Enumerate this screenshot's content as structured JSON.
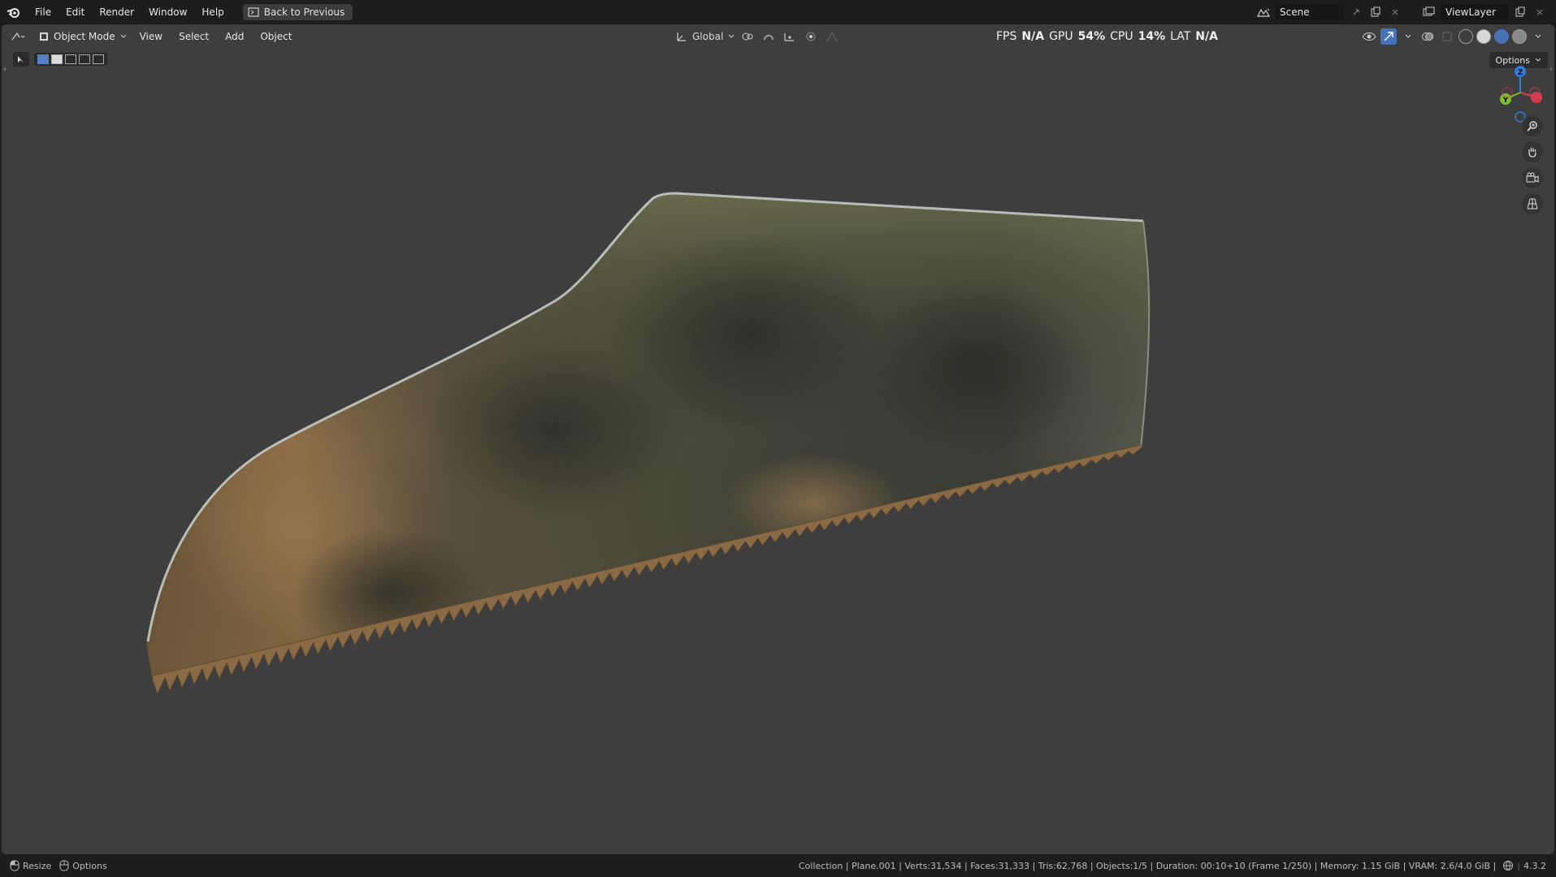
{
  "menu": {
    "items": [
      "File",
      "Edit",
      "Render",
      "Window",
      "Help"
    ],
    "back_label": "Back to Previous"
  },
  "scene": {
    "name": "Scene",
    "view_layer": "ViewLayer"
  },
  "viewport": {
    "mode": "Object Mode",
    "menus": [
      "View",
      "Select",
      "Add",
      "Object"
    ],
    "transform_orientation": "Global",
    "options_label": "Options"
  },
  "stats": {
    "fps_label": "FPS",
    "fps_value": "N/A",
    "gpu_label": "GPU",
    "gpu_value": "54%",
    "cpu_label": "CPU",
    "cpu_value": "14%",
    "lat_label": "LAT",
    "lat_value": "N/A"
  },
  "gizmo": {
    "z": "Z",
    "y": "Y"
  },
  "status": {
    "left": [
      {
        "label": "Resize"
      },
      {
        "label": "Options"
      }
    ],
    "right": "Collection | Plane.001 | Verts:31,534 | Faces:31,333 | Tris:62,768 | Objects:1/5 | Duration: 00:10+10 (Frame 1/250) | Memory: 1.15 GiB | VRAM: 2.6/4.0 GiB |",
    "version": "4.3.2"
  },
  "colors": {
    "accent": "#4772b3",
    "axis_x": "#d63c4f",
    "axis_y": "#7fbf2d",
    "axis_z": "#2f7bd6"
  }
}
